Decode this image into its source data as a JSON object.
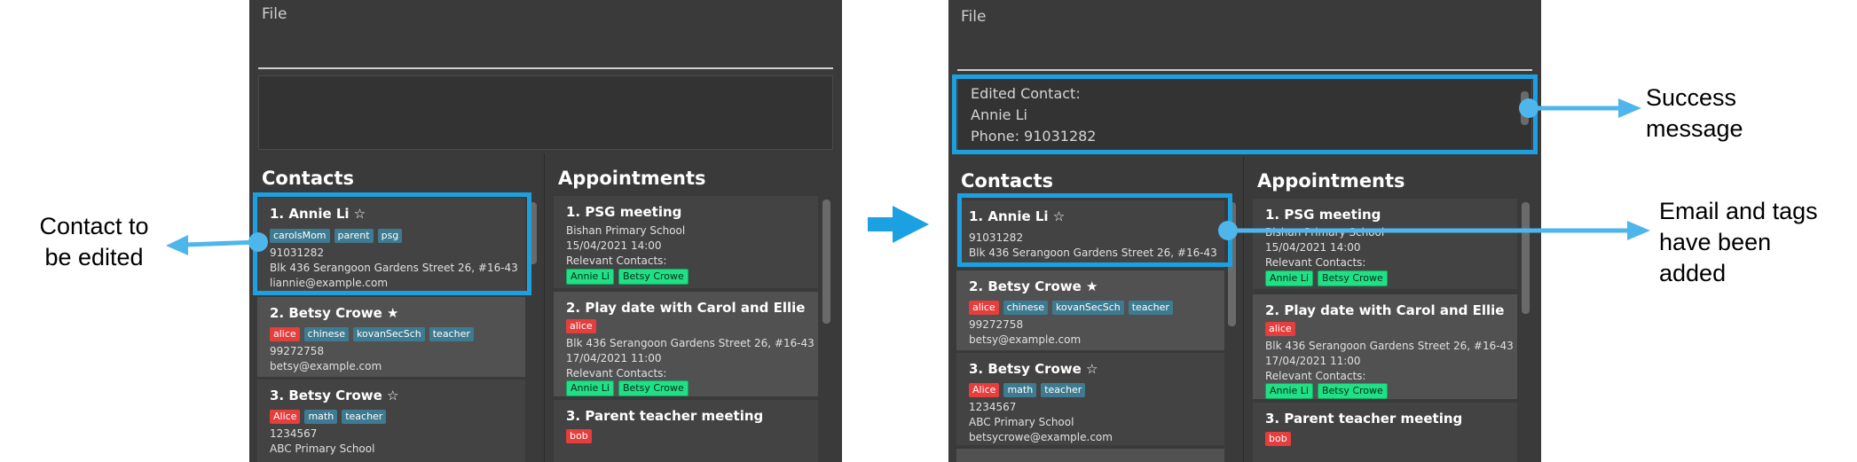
{
  "menu": {
    "file": "File"
  },
  "panels": {
    "contacts_title": "Contacts",
    "appointments_title": "Appointments"
  },
  "before": {
    "contacts": [
      {
        "name": "1.  Annie Li ☆",
        "tags": [
          {
            "text": "carolsMom",
            "color": "blue"
          },
          {
            "text": "parent",
            "color": "blue"
          },
          {
            "text": "psg",
            "color": "blue"
          }
        ],
        "phone": "91031282",
        "address": "Blk 436 Serangoon Gardens Street 26, #16-43",
        "email": "liannie@example.com"
      },
      {
        "name": "2.  Betsy Crowe ★",
        "tags": [
          {
            "text": "alice",
            "color": "red"
          },
          {
            "text": "chinese",
            "color": "blue"
          },
          {
            "text": "kovanSecSch",
            "color": "blue"
          },
          {
            "text": "teacher",
            "color": "blue"
          }
        ],
        "phone": "99272758",
        "email": "betsy@example.com"
      },
      {
        "name": "3.  Betsy Crowe ☆",
        "tags": [
          {
            "text": "Alice",
            "color": "red"
          },
          {
            "text": "math",
            "color": "blue"
          },
          {
            "text": "teacher",
            "color": "blue"
          }
        ],
        "phone": "1234567",
        "address": "ABC Primary School"
      }
    ],
    "appointments": [
      {
        "title": "1.  PSG meeting",
        "location": "Bishan Primary School",
        "datetime": "15/04/2021 14:00",
        "relevant": "Relevant Contacts:",
        "contacts": [
          "Annie Li",
          "Betsy Crowe"
        ]
      },
      {
        "title": "2.  Play date with Carol and Ellie",
        "tags": [
          "alice"
        ],
        "location": "Blk 436 Serangoon Gardens Street 26, #16-43",
        "datetime": "17/04/2021 11:00",
        "relevant": "Relevant Contacts:",
        "contacts": [
          "Annie Li",
          "Betsy Crowe"
        ]
      },
      {
        "title": "3.  Parent teacher meeting",
        "tags": [
          "bob"
        ]
      }
    ]
  },
  "after": {
    "result": [
      "Edited Contact:",
      "Annie Li",
      "Phone: 91031282"
    ],
    "contacts": [
      {
        "name": "1.  Annie Li ☆",
        "phone": "91031282",
        "address": "Blk 436 Serangoon Gardens Street 26, #16-43"
      },
      {
        "name": "2.  Betsy Crowe ★",
        "tags": [
          {
            "text": "alice",
            "color": "red"
          },
          {
            "text": "chinese",
            "color": "blue"
          },
          {
            "text": "kovanSecSch",
            "color": "blue"
          },
          {
            "text": "teacher",
            "color": "blue"
          }
        ],
        "phone": "99272758",
        "email": "betsy@example.com"
      },
      {
        "name": "3.  Betsy Crowe ☆",
        "tags": [
          {
            "text": "Alice",
            "color": "red"
          },
          {
            "text": "math",
            "color": "blue"
          },
          {
            "text": "teacher",
            "color": "blue"
          }
        ],
        "phone": "1234567",
        "address": "ABC Primary School",
        "email": "betsycrowe@example.com"
      }
    ],
    "appointments": [
      {
        "title": "1.  PSG meeting",
        "location": "Bishan Primary School",
        "datetime": "15/04/2021 14:00",
        "relevant": "Relevant Contacts:",
        "contacts": [
          "Annie Li",
          "Betsy Crowe"
        ]
      },
      {
        "title": "2.  Play date with Carol and Ellie",
        "tags": [
          "alice"
        ],
        "location": "Blk 436 Serangoon Gardens Street 26, #16-43",
        "datetime": "17/04/2021 11:00",
        "relevant": "Relevant Contacts:",
        "contacts": [
          "Annie Li",
          "Betsy Crowe"
        ]
      },
      {
        "title": "3.  Parent teacher meeting",
        "tags": [
          "bob"
        ]
      }
    ]
  },
  "annotations": {
    "left_label": [
      "Contact to",
      "be edited"
    ],
    "success_label": [
      "Success",
      "message"
    ],
    "email_label": [
      "Email and tags",
      "have been",
      "added"
    ]
  },
  "colors": {
    "highlight": "#1ba1e2",
    "arrow": "#4fb6ec",
    "tag_blue": "#3e7b91",
    "tag_red": "#e63d3d",
    "tag_green": "#1fe084"
  }
}
